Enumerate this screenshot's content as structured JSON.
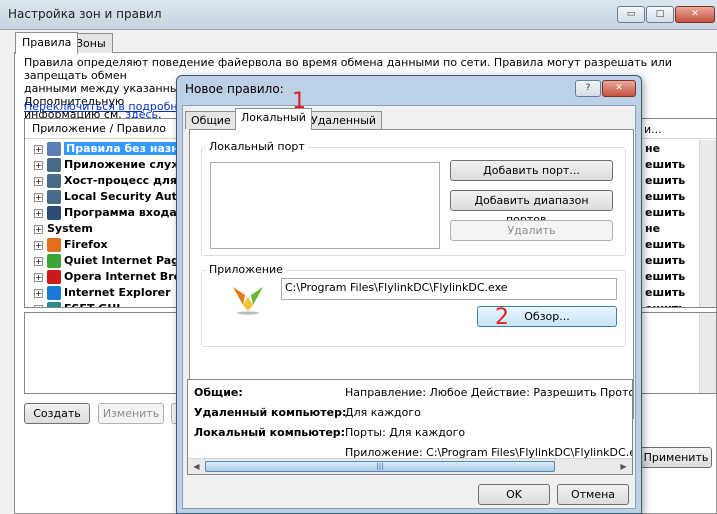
{
  "outer": {
    "title": "Настройка зон и правил",
    "caption_min": "▭",
    "caption_max": "□",
    "caption_close": "✕",
    "tabs": [
      "Правила",
      "Зоны"
    ],
    "description_line1": "Правила определяют поведение файервола во время обмена данными по сети. Правила могут разрешать или запрещать обмен",
    "description_line2": "данными между указанными приложениями, удаленными компьютерами или отдельными портами. Дополнительную",
    "description_line3_prefix": "информацию см. ",
    "description_link": "здесь",
    "description_line3_suffix": ".",
    "switch_link": "Переключиться в подробный",
    "list_header": "Приложение / Правило",
    "list_header_right": "и...",
    "rows": [
      {
        "label": "Правила без назначен",
        "expander": "+",
        "icon": "rules-icon",
        "color": "#5b7fb4",
        "right": "не"
      },
      {
        "label": "Приложение служб",
        "expander": "+",
        "icon": "service-icon",
        "color": "#4a6a8a",
        "right": "ешить"
      },
      {
        "label": "Хост-процесс для с",
        "expander": "+",
        "icon": "host-process-icon",
        "color": "#4a6a8a",
        "right": "ешить"
      },
      {
        "label": "Local Security Autho",
        "expander": "+",
        "icon": "security-icon",
        "color": "#4a6a8a",
        "right": "ешить"
      },
      {
        "label": "Программа входа в",
        "expander": "+",
        "icon": "logon-icon",
        "color": "#2b4c78",
        "right": "ешить"
      },
      {
        "label": "System",
        "expander": "+",
        "icon": "",
        "color": "",
        "right": "не"
      },
      {
        "label": "Firefox",
        "expander": "+",
        "icon": "firefox-icon",
        "color": "#e0701a",
        "right": "ешить"
      },
      {
        "label": "Quiet Internet Page",
        "expander": "+",
        "icon": "qip-icon",
        "color": "#3aa63a",
        "right": "ешить"
      },
      {
        "label": "Opera Internet Brow",
        "expander": "+",
        "icon": "opera-icon",
        "color": "#cc1a1a",
        "right": "ешить"
      },
      {
        "label": "Internet Explorer",
        "expander": "+",
        "icon": "ie-icon",
        "color": "#1a78d6",
        "right": "ешить"
      },
      {
        "label": "ESET GUI",
        "expander": "+",
        "icon": "eset-icon",
        "color": "#2b8a8a",
        "right": "ешить"
      }
    ],
    "btn_create": "Создать",
    "btn_edit": "Изменить",
    "btn_apply": "Применить"
  },
  "dialog": {
    "title": "Новое правило:",
    "help": "?",
    "close": "✕",
    "tabs": [
      "Общие",
      "Локальный",
      "Удаленный"
    ],
    "local_port_group": "Локальный порт",
    "btn_add_port": "Добавить порт...",
    "btn_add_range": "Добавить диапазон портов...",
    "btn_remove": "Удалить",
    "app_group": "Приложение",
    "app_path": "C:\\Program Files\\FlylinkDC\\FlylinkDC.exe",
    "btn_browse": "Обзор...",
    "summary": [
      {
        "key": "Общие:",
        "value": "Направление: Любое    Действие: Разрешить    Прото"
      },
      {
        "key": "Удаленный компьютер:",
        "value": "Для каждого"
      },
      {
        "key": "Локальный компьютер:",
        "value": "Порты: Для каждого"
      },
      {
        "key": "",
        "value": "Приложение: C:\\Program Files\\FlylinkDC\\FlylinkDC.exe"
      }
    ],
    "scroll_grip": "|||",
    "btn_ok": "OK",
    "btn_cancel": "Отмена",
    "annotation_1": "1",
    "annotation_2": "2"
  }
}
